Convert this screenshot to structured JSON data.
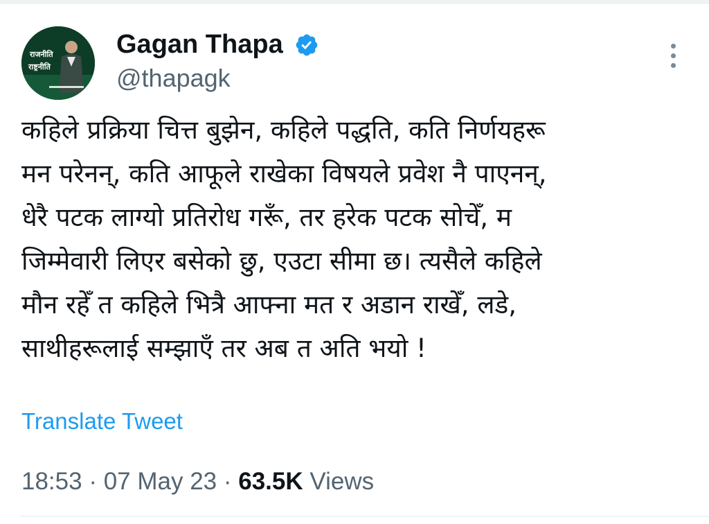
{
  "author": {
    "display_name": "Gagan Thapa",
    "handle": "@thapagk",
    "verified": true,
    "avatar_text": [
      "राजनीति",
      "राष्ट्रनीति"
    ]
  },
  "tweet": {
    "lines": [
      "कहिले प्रक्रिया चित्त बुझेन, कहिले पद्धति, कति निर्णयहरू",
      "मन परेनन्, कति आफूले राखेका विषयले प्रवेश नै पाएनन्,",
      "धेरै पटक लाग्यो प्रतिरोध गरूँ, तर हरेक पटक सोचेँ, म",
      "जिम्मेवारी लिएर बसेको छु, एउटा सीमा छ। त्यसैले कहिले",
      "मौन रहेँ त कहिले भित्रै आफ्ना मत र अडान राखेँ, लडे,",
      "साथीहरूलाई सम्झाएँ तर अब त अति भयो !"
    ],
    "translate_label": "Translate Tweet",
    "time": "18:53",
    "separator": " · ",
    "date": "07 May 23",
    "views_count": "63.5K",
    "views_label": " Views"
  },
  "colors": {
    "link": "#1d9bf0",
    "verified": "#1d9bf0",
    "muted": "#536471",
    "text": "#0f1419"
  },
  "icons": {
    "verified": "verified-badge-icon",
    "more": "more-vertical-icon"
  }
}
